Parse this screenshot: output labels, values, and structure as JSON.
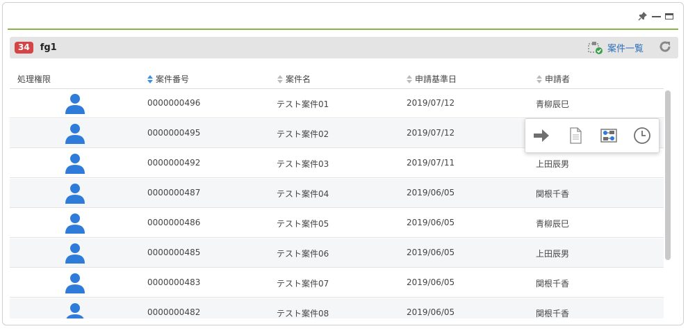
{
  "panel": {
    "count_badge": "34",
    "title": "fg1",
    "list_link_label": "案件一覧"
  },
  "table": {
    "headers": [
      "処理権限",
      "案件番号",
      "案件名",
      "申請基準日",
      "申請者"
    ],
    "rows": [
      {
        "case_no": "0000000496",
        "case_name": "テスト案件01",
        "date": "2019/07/12",
        "applicant": "青柳辰巳"
      },
      {
        "case_no": "0000000495",
        "case_name": "テスト案件02",
        "date": "2019/07/12",
        "applicant": ""
      },
      {
        "case_no": "0000000492",
        "case_name": "テスト案件03",
        "date": "2019/07/11",
        "applicant": "上田辰男"
      },
      {
        "case_no": "0000000487",
        "case_name": "テスト案件04",
        "date": "2019/06/05",
        "applicant": "関根千香"
      },
      {
        "case_no": "0000000486",
        "case_name": "テスト案件05",
        "date": "2019/06/05",
        "applicant": "青柳辰巳"
      },
      {
        "case_no": "0000000485",
        "case_name": "テスト案件06",
        "date": "2019/06/05",
        "applicant": "上田辰男"
      },
      {
        "case_no": "0000000483",
        "case_name": "テスト案件07",
        "date": "2019/06/05",
        "applicant": "関根千香"
      },
      {
        "case_no": "0000000482",
        "case_name": "テスト案件08",
        "date": "2019/06/05",
        "applicant": "関根千香"
      }
    ]
  },
  "popup_actions": [
    "arrow-right-icon",
    "document-icon",
    "flow-icon",
    "clock-icon"
  ],
  "colors": {
    "accent_line": "#8ab34a",
    "badge": "#d64545",
    "user_icon": "#2f7bd9",
    "link": "#2a6ebb"
  }
}
